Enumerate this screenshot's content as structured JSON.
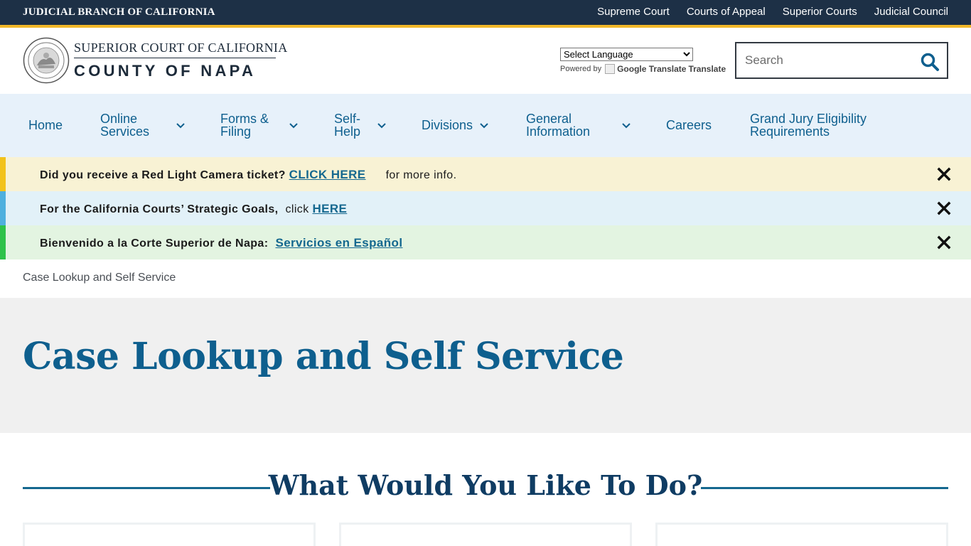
{
  "topbar": {
    "branch": "JUDICIAL BRANCH OF CALIFORNIA",
    "links": [
      "Supreme Court",
      "Courts of Appeal",
      "Superior Courts",
      "Judicial Council"
    ]
  },
  "header": {
    "logo_line1": "SUPERIOR COURT OF CALIFORNIA",
    "logo_line2": "COUNTY OF NAPA",
    "language_select": "Select Language",
    "powered_by": "Powered by",
    "google_translate": "Google Translate",
    "translate": "Translate",
    "search_placeholder": "Search"
  },
  "nav": {
    "items": [
      {
        "label": "Home"
      },
      {
        "label": "Online",
        "label2": "Services"
      },
      {
        "label": "Forms &",
        "label2": "Filing"
      },
      {
        "label": "Self-",
        "label2": "Help"
      },
      {
        "label": "Divisions"
      },
      {
        "label": "General",
        "label2": "Information"
      },
      {
        "label": "Careers"
      },
      {
        "label": "Grand Jury Eligibility",
        "label2": "Requirements"
      }
    ]
  },
  "alerts": [
    {
      "lead": "Did you receive a Red Light Camera ticket?",
      "link": "CLICK HERE",
      "tail": "for more info.",
      "color": "#f2c21b",
      "bg": "#f8f2d4"
    },
    {
      "lead": "For the California Courts’ Strategic Goals,",
      "mid": "click",
      "link": "HERE",
      "color": "#4fb0de",
      "bg": "#e2f1f8"
    },
    {
      "lead": "Bienvenido a la Corte Superior de Napa:",
      "link": "Servicios en Español",
      "color": "#2ec24a",
      "bg": "#e3f4e1"
    }
  ],
  "breadcrumb": "Case Lookup and Self Service",
  "hero": {
    "title": "Case Lookup and Self Service"
  },
  "section": {
    "heading": "What Would You Like To Do?"
  },
  "colors": {
    "navy": "#1d3046",
    "accent": "#f2b728",
    "link": "#0e5f8e",
    "heading": "#0f3c63"
  }
}
